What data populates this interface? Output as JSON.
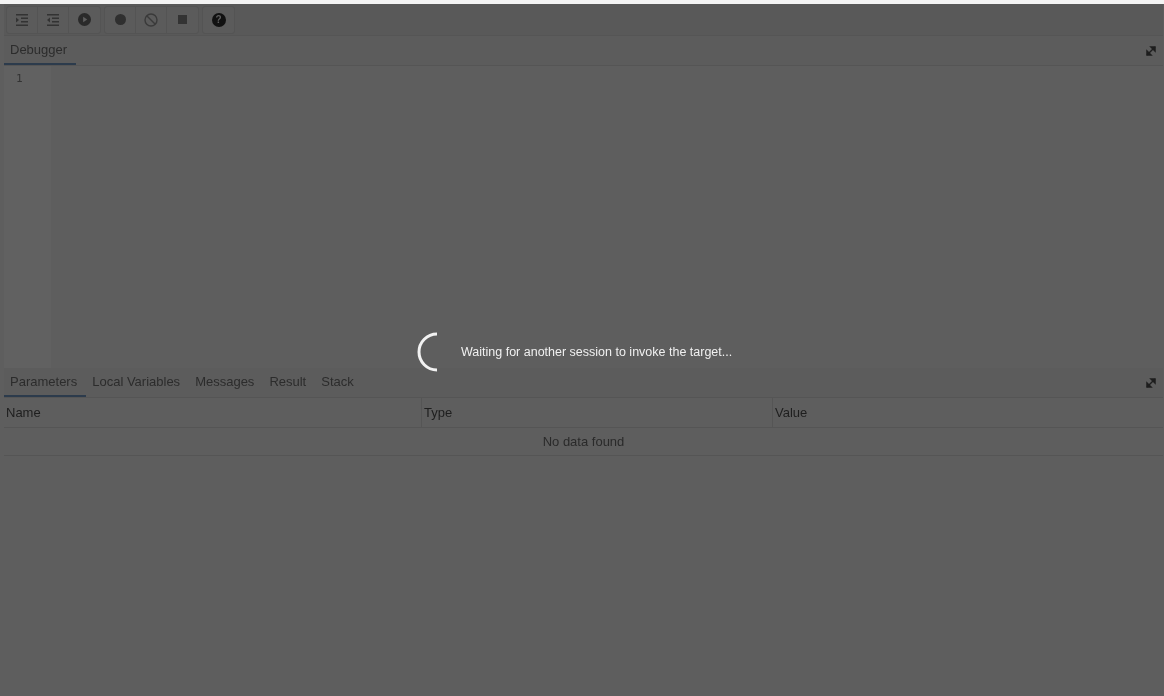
{
  "toolbar": {
    "help_glyph": "?"
  },
  "editor_panel": {
    "tabs": [
      {
        "label": "Debugger",
        "selected": true
      }
    ],
    "line_numbers": [
      "1"
    ]
  },
  "loading": {
    "message": "Waiting for another session to invoke the target..."
  },
  "results_panel": {
    "tabs": [
      {
        "label": "Parameters",
        "selected": true
      },
      {
        "label": "Local Variables",
        "selected": false
      },
      {
        "label": "Messages",
        "selected": false
      },
      {
        "label": "Result",
        "selected": false
      },
      {
        "label": "Stack",
        "selected": false
      }
    ],
    "table": {
      "columns": [
        "Name",
        "Type",
        "Value"
      ],
      "empty_message": "No data found"
    }
  }
}
